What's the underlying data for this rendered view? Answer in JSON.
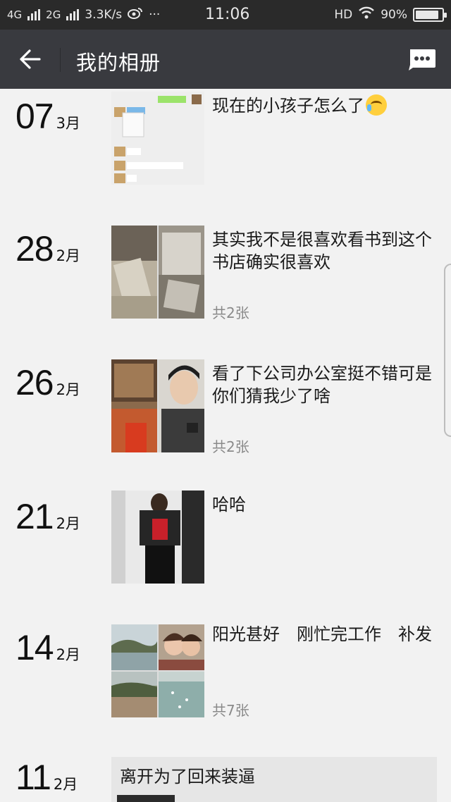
{
  "status_bar": {
    "network_1": "4G",
    "network_2": "2G",
    "speed": "3.3K/s",
    "dots": "···",
    "time": "11:06",
    "hd": "HD",
    "battery_text": "90%",
    "battery_level": 0.9
  },
  "header": {
    "title": "我的相册",
    "back_icon": "arrow-left-icon",
    "message_icon": "chat-bubble-icon"
  },
  "entries": [
    {
      "day": "07",
      "month": "3月",
      "caption": "现在的小孩子怎么了",
      "emoji": "crying-laughing-emoji",
      "count": ""
    },
    {
      "day": "28",
      "month": "2月",
      "caption": "其实我不是很喜欢看书到这个书店确实很喜欢",
      "count": "共2张"
    },
    {
      "day": "26",
      "month": "2月",
      "caption": "看了下公司办公室挺不错可是你们猜我少了啥",
      "count": "共2张"
    },
    {
      "day": "21",
      "month": "2月",
      "caption": "哈哈",
      "count": ""
    },
    {
      "day": "14",
      "month": "2月",
      "caption": "阳光甚好　刚忙完工作　补发",
      "count": "共7张"
    },
    {
      "day": "11",
      "month": "2月",
      "caption": "离开为了回来装逼",
      "count": ""
    }
  ],
  "colors": {
    "status_bar_bg": "#2a2a2a",
    "title_bar_bg": "#393a3f",
    "page_bg": "#f2f2f2",
    "count_text": "#8a8a8a"
  }
}
